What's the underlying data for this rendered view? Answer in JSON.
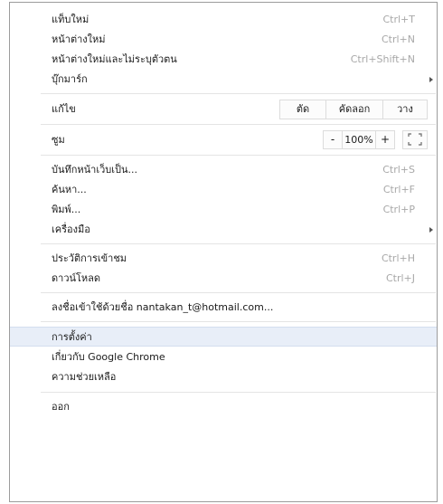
{
  "menu": {
    "new_tab": {
      "label": "แท็บใหม่",
      "shortcut": "Ctrl+T"
    },
    "new_window": {
      "label": "หน้าต่างใหม่",
      "shortcut": "Ctrl+N"
    },
    "incognito_window": {
      "label": "หน้าต่างใหม่และไม่ระบุตัวตน",
      "shortcut": "Ctrl+Shift+N"
    },
    "bookmarks": {
      "label": "บุ๊กมาร์ก"
    },
    "edit": {
      "label": "แก้ไข",
      "cut": "ตัด",
      "copy": "คัดลอก",
      "paste": "วาง"
    },
    "zoom": {
      "label": "ซูม",
      "minus": "-",
      "value": "100%",
      "plus": "+"
    },
    "save_page": {
      "label": "บันทึกหน้าเว็บเป็น...",
      "shortcut": "Ctrl+S"
    },
    "find": {
      "label": "ค้นหา...",
      "shortcut": "Ctrl+F"
    },
    "print": {
      "label": "พิมพ์...",
      "shortcut": "Ctrl+P"
    },
    "tools": {
      "label": "เครื่องมือ"
    },
    "history": {
      "label": "ประวัติการเข้าชม",
      "shortcut": "Ctrl+H"
    },
    "downloads": {
      "label": "ดาวน์โหลด",
      "shortcut": "Ctrl+J"
    },
    "sign_in": {
      "label": "ลงชื่อเข้าใช้ด้วยชื่อ nantakan_t@hotmail.com..."
    },
    "settings": {
      "label": "การตั้งค่า"
    },
    "about": {
      "label": "เกี่ยวกับ Google Chrome"
    },
    "help": {
      "label": "ความช่วยเหลือ"
    },
    "exit": {
      "label": "ออก"
    }
  },
  "colors": {
    "highlight": "#e8eef8",
    "shortcut_text": "#a8a8a8",
    "separator": "#e4e4e4"
  },
  "icons": {
    "submenu": "triangle-right-icon",
    "fullscreen": "fullscreen-icon"
  }
}
